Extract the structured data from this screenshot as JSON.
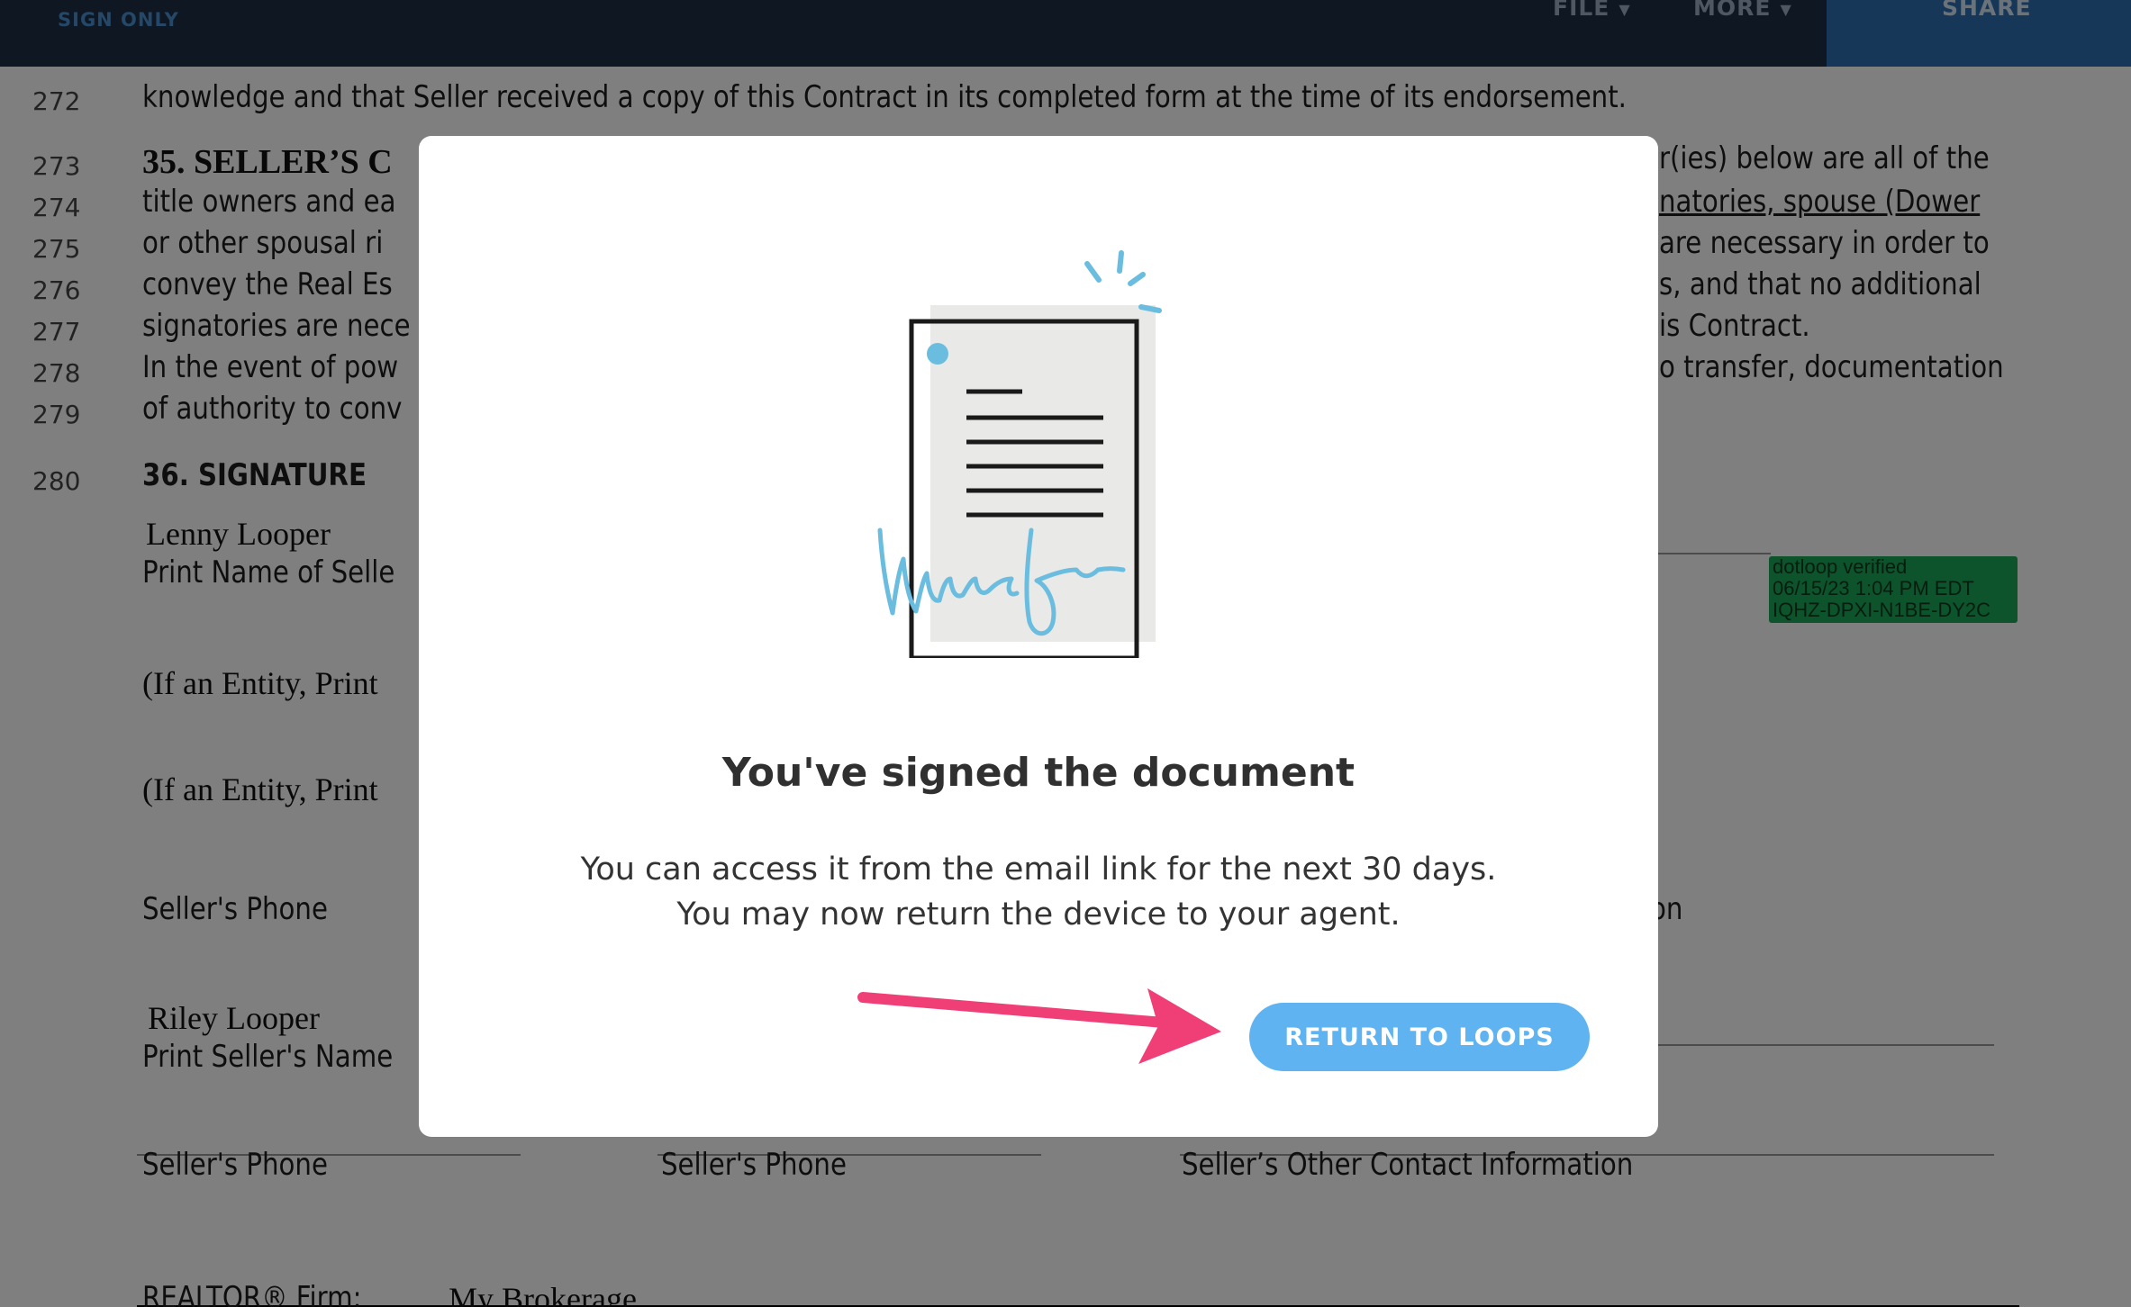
{
  "topbar": {
    "mode_label": "SIGN ONLY",
    "file_menu": "FILE",
    "more_menu": "MORE",
    "share_label": "SHARE"
  },
  "document": {
    "lines": [
      {
        "num": "272",
        "text": "knowledge and that Seller received a copy of this Contract in its completed form at the time of its endorsement."
      },
      {
        "num": "273",
        "heading": "35.  SELLER’S C",
        "text_right": "r(ies) below are all of the"
      },
      {
        "num": "274",
        "text": "title owners and ea",
        "text_right": "natories, spouse (Dower"
      },
      {
        "num": "275",
        "text": "or other spousal ri",
        "text_right": "are necessary in order to"
      },
      {
        "num": "276",
        "text": "convey the Real Es",
        "text_right": "s,  and that no additional"
      },
      {
        "num": "277",
        "text": "signatories are nece",
        "text_right": "is Contract."
      },
      {
        "num": "278",
        "text": "In the event of pow",
        "text_right": "o transfer, documentation"
      },
      {
        "num": "279",
        "text": "of authority to conv"
      },
      {
        "num": "280",
        "heading": "36.  SIGNATURE"
      }
    ],
    "seller1_name": "Lenny Looper",
    "print_name_seller": "Print Name of Selle",
    "entity_line_1": "(If an Entity, Print",
    "entity_line_2": "(If an Entity, Print",
    "sellers_phone_1": "Seller's Phone",
    "right_fragment_on": "on",
    "seller2_name": "Riley Looper",
    "print_sellers_name": "Print Seller's Name",
    "sellers_phone_2": "Seller's Phone",
    "sellers_phone_3": "Seller's Phone",
    "sellers_other_contact": "Seller’s Other Contact Information",
    "firm_label": "REALTOR® Firm:",
    "firm_value": "My Brokerage",
    "verification": {
      "line1": "dotloop verified",
      "line2": "06/15/23 1:04 PM EDT",
      "line3": "IQHZ-DPXI-N1BE-DY2C"
    }
  },
  "modal": {
    "illustration_icon": "signed-document-icon",
    "title": "You've signed the document",
    "body_line1": "You can access it from the email link for the next 30 days.",
    "body_line2": "You may now return the device to your agent.",
    "button_label": "RETURN TO LOOPS"
  },
  "colors": {
    "topbar": "#1d2e44",
    "share": "#2e6fb3",
    "accent_blue": "#5fb3f0",
    "signature_blue": "#6bbde0",
    "arrow_pink": "#f03f77",
    "verified_green": "#1aa85a"
  }
}
